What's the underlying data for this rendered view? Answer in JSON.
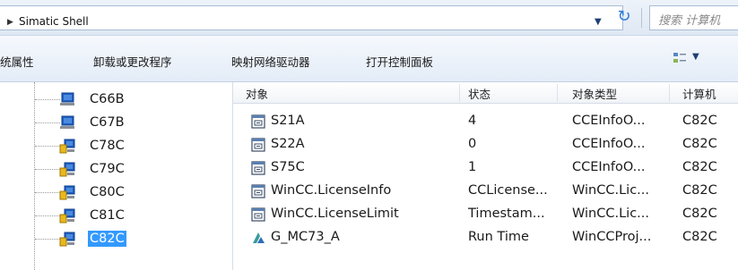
{
  "address_bar": {
    "expand_glyph": "▶",
    "path": "Simatic Shell",
    "dropdown_glyph": "▼",
    "refresh_glyph": "↻",
    "search_placeholder": "搜索 计算机"
  },
  "command_bar": {
    "items": [
      "统属性",
      "卸载或更改程序",
      "映射网络驱动器",
      "打开控制面板"
    ],
    "view_icon": "view-options-icon",
    "view_dropdown_glyph": "▼"
  },
  "tree": {
    "items": [
      {
        "label": "C66B",
        "icon": "computer-icon",
        "selected": false
      },
      {
        "label": "C67B",
        "icon": "computer-icon",
        "selected": false
      },
      {
        "label": "C78C",
        "icon": "server-computer-icon",
        "selected": false
      },
      {
        "label": "C79C",
        "icon": "server-computer-icon",
        "selected": false
      },
      {
        "label": "C80C",
        "icon": "server-computer-icon",
        "selected": false
      },
      {
        "label": "C81C",
        "icon": "server-computer-icon",
        "selected": false
      },
      {
        "label": "C82C",
        "icon": "server-computer-icon",
        "selected": true
      }
    ]
  },
  "list": {
    "columns": [
      "对象",
      "状态",
      "对象类型",
      "计算机"
    ],
    "rows": [
      {
        "icon": "info-object-icon",
        "name": "S21A",
        "status": "4",
        "type": "CCEInfoO...",
        "computer": "C82C"
      },
      {
        "icon": "info-object-icon",
        "name": "S22A",
        "status": "0",
        "type": "CCEInfoO...",
        "computer": "C82C"
      },
      {
        "icon": "info-object-icon",
        "name": "S75C",
        "status": "1",
        "type": "CCEInfoO...",
        "computer": "C82C"
      },
      {
        "icon": "info-object-icon",
        "name": "WinCC.LicenseInfo",
        "status": "CCLicense...",
        "type": "WinCC.Lic...",
        "computer": "C82C"
      },
      {
        "icon": "info-object-icon",
        "name": "WinCC.LicenseLimit",
        "status": "Timestam...",
        "type": "WinCC.Lic...",
        "computer": "C82C"
      },
      {
        "icon": "wincc-project-icon",
        "name": "G_MC73_A",
        "status": "Run Time",
        "type": "WinCCProj...",
        "computer": "C82C"
      }
    ]
  },
  "colors": {
    "selection": "#3399ff",
    "refresh_icon": "#2c7bd8",
    "monitor_blue": "#1f5fbf",
    "server_yellow": "#e8b820"
  }
}
